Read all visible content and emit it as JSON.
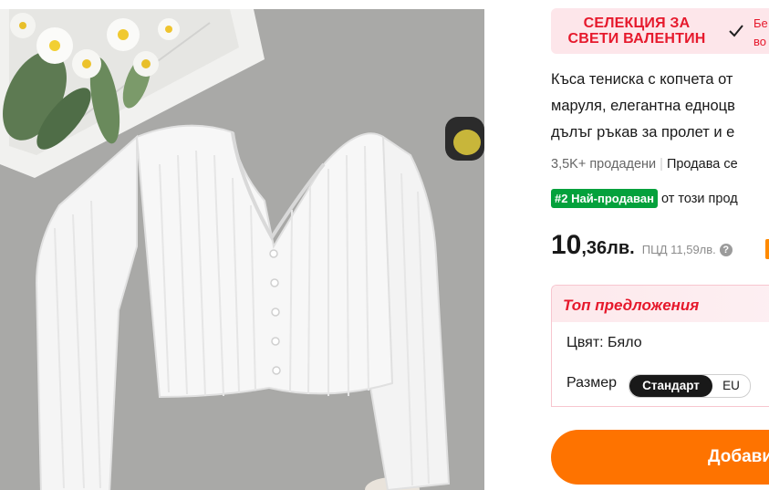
{
  "banner": {
    "title_line1": "СЕЛЕКЦИЯ ЗА",
    "title_line2": "СВЕТИ ВАЛЕНТИН",
    "side_line1": "Бе",
    "side_line2": "во"
  },
  "product": {
    "title_lines": [
      "Къса тениска с копчета от",
      "маруля, елегантна едноцв",
      "дълъг ръкав за пролет и е"
    ],
    "sold": "3,5K+ продадени",
    "seller": "Продава се",
    "rank_badge": "#2 Най-продаван",
    "rank_text": "от този прод",
    "price_int": "10",
    "price_dec": ",36лв.",
    "old_price": "ПЦД 11,59лв.",
    "help_icon_text": "?"
  },
  "offers": {
    "heading": "Топ предложения",
    "color_label": "Цвят: Бяло",
    "size_label": "Размер",
    "size_options": [
      "Стандарт",
      "EU"
    ],
    "size_selected": "Стандарт"
  },
  "cart": {
    "add_label": "Добави"
  },
  "colors": {
    "accent_red": "#e6192c",
    "rank_green": "#04a13c",
    "button_orange": "#fe7300"
  },
  "icons": [
    "checkmark-icon",
    "help-icon"
  ]
}
